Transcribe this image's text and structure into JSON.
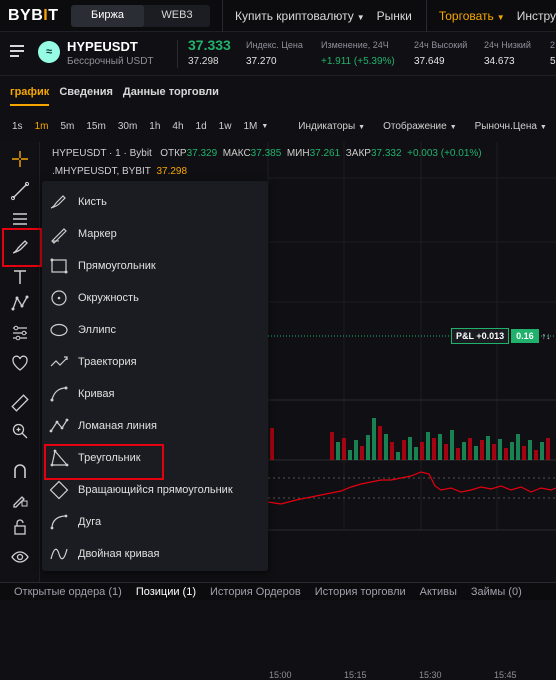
{
  "topnav": {
    "logo_main": "BYB",
    "logo_bar": "I",
    "logo_end": "T",
    "segments": [
      "Биржа",
      "WEB3"
    ],
    "items": [
      "Купить криптовалюту",
      "Рынки",
      "Торговать",
      "Инстру"
    ]
  },
  "ticker": {
    "icon_letter": "≈",
    "symbol": "HYPEUSDT",
    "subtitle": "Бессрочный USDT",
    "last_price": "37.333",
    "mark_price": "37.298",
    "stats": [
      {
        "label": "Индекс. Цена",
        "value": "37.270"
      },
      {
        "label": "Изменение, 24Ч",
        "value": "+1.911 (+5.39%)"
      },
      {
        "label": "24ч Высокий",
        "value": "37.649"
      },
      {
        "label": "24ч Низкий",
        "value": "34.673"
      },
      {
        "label": "2",
        "value": "5"
      }
    ]
  },
  "tabs": [
    "график",
    "Сведения",
    "Данные торговли"
  ],
  "timeframes": [
    "1s",
    "1m",
    "5m",
    "15m",
    "30m",
    "1h",
    "4h",
    "1d",
    "1w",
    "1M"
  ],
  "chart_controls": [
    "Индикаторы",
    "Отображение",
    "Рыночн.Цена"
  ],
  "chart_header": {
    "line1_prefix": "HYPEUSDT · 1 · Bybit",
    "open_label": "ОТКР",
    "open_value": "37.329",
    "max_label": "МАКС",
    "max_value": "37.385",
    "min_label": "МИН",
    "min_value": "37.261",
    "close_label": "ЗАКР",
    "close_value": "37.332",
    "change": "+0.003 (+0.01%)",
    "line2_prefix": ".MHYPEUSDT, BYBIT",
    "line2_value": "37.298"
  },
  "dropdown": [
    "Кисть",
    "Маркер",
    "Прямоугольник",
    "Окружность",
    "Эллипс",
    "Траектория",
    "Кривая",
    "Ломаная линия",
    "Треугольник",
    "Вращающийся прямоугольник",
    "Дуга",
    "Двойная кривая"
  ],
  "pnl": {
    "label": "P&L +0.013",
    "value": "0.16",
    "icon": "↑↓"
  },
  "time_labels": [
    "15:00",
    "15:15",
    "15:30",
    "15:45"
  ],
  "bottom_tabs": [
    "Открытые ордера (1)",
    "Позиции (1)",
    "История Ордеров",
    "История торговли",
    "Активы",
    "Займы (0)"
  ],
  "colors": {
    "accent": "#f7a600",
    "up": "#20b26c",
    "down": "#e4000f",
    "highlight": "#e4000f"
  }
}
